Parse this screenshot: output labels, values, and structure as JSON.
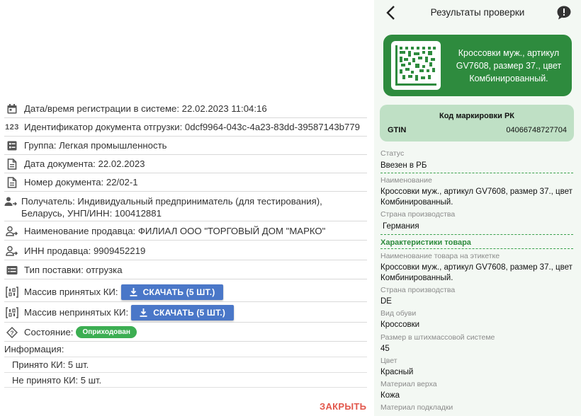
{
  "left": {
    "rows": [
      {
        "label": "Дата/время регистрации в системе: 22.02.2023 11:04:16"
      },
      {
        "label": "Идентификатор документа отгрузки: 0dcf9964-043c-4a23-83dd-39587143b779"
      },
      {
        "label": "Группа: Легкая промышленность"
      },
      {
        "label": "Дата документа: 22.02.2023"
      },
      {
        "label": "Номер документа: 22/02-1"
      },
      {
        "label": "Получатель: Индивидуальный предприниматель (для тестирования), Беларусь, УНП/ИНН: 100412881"
      },
      {
        "label": "Наименование продавца: ФИЛИАЛ ООО \"ТОРГОВЫЙ ДОМ \"МАРКО\""
      },
      {
        "label": "ИНН продавца: 9909452219"
      },
      {
        "label": "Тип поставки: отгрузка"
      },
      {
        "label": "Массив принятых КИ:"
      },
      {
        "label": "Массив непринятых КИ:"
      },
      {
        "label": "Состояние:"
      }
    ],
    "download_accepted": "СКАЧАТЬ (5 ШТ.)",
    "download_rejected": "СКАЧАТЬ (5 ШТ.)",
    "status_badge": "Оприходован",
    "info_title": "Информация:",
    "info_accepted": "Принято КИ: 5 шт.",
    "info_rejected": "Не принято КИ: 5 шт.",
    "close_label": "ЗАКРЫТЬ",
    "counter_icon_text": "123"
  },
  "right": {
    "title": "Результаты проверки",
    "card_text": "Кроссовки муж., артикул GV7608, размер 37., цвет Комбинированный.",
    "code_title": "Код маркировки РК",
    "gtin_label": "GTIN",
    "gtin_value": "04066748727704",
    "status_label": "Статус",
    "status_value": "Ввезен в РБ",
    "name_label": "Наименование",
    "name_value": "Кроссовки муж., артикул GV7608, размер 37., цвет Комбинированный.",
    "country_label": "Страна производства",
    "country_value": "Германия",
    "section_title": "Характеристики товара",
    "label_name_label": "Наименование товара на этикетке",
    "label_name_value": "Кроссовки муж., артикул GV7608, размер 37., цвет Комбинированный.",
    "country2_label": "Страна производства",
    "country2_value": "DE",
    "shoe_type_label": "Вид обуви",
    "shoe_type_value": "Кроссовки",
    "size_label": "Размер в штихмассовой системе",
    "size_value": "45",
    "color_label": "Цвет",
    "color_value": "Красный",
    "upper_label": "Материал верха",
    "upper_value": "Кожа",
    "lining_label": "Материал подкладки"
  },
  "colors": {
    "accent_blue": "#4a77c8",
    "badge_green": "#3cae52",
    "card_green": "#2e8b3e",
    "code_card": "#bfe0c5",
    "close_red": "#e2574c"
  }
}
